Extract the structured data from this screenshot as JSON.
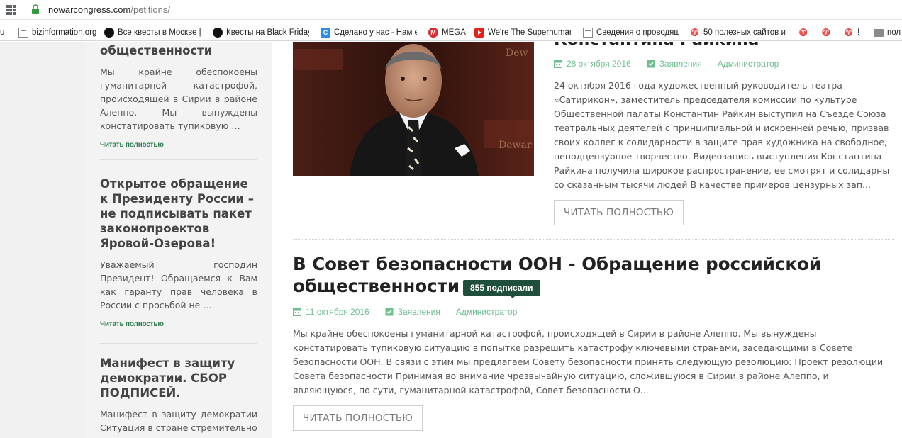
{
  "browser": {
    "url_host": "nowarcongress.com",
    "url_path": "/petitions/",
    "bookmarks": [
      {
        "label": "u",
        "icon": "none"
      },
      {
        "label": "bizinformation.org",
        "icon": "document-icon"
      },
      {
        "label": "Все квесты в Москве |",
        "icon": "quest-icon"
      },
      {
        "label": "Квесты на Black Friday",
        "icon": "quest-icon"
      },
      {
        "label": "Сделано у нас - Нам е",
        "icon": "c-icon"
      },
      {
        "label": "MEGA",
        "icon": "mega-icon"
      },
      {
        "label": "We're The Superhuman",
        "icon": "youtube-icon"
      },
      {
        "label": "Сведения о проводящ",
        "icon": "document-icon"
      },
      {
        "label": "50 полезных сайтов и",
        "icon": "red-icon"
      },
      {
        "label": "",
        "icon": "red-icon"
      },
      {
        "label": "",
        "icon": "red-icon"
      },
      {
        "label": "!",
        "icon": "red-icon"
      },
      {
        "label": "пол",
        "icon": "folder-icon"
      }
    ]
  },
  "sidebar": {
    "items": [
      {
        "title": "общественности",
        "excerpt": "Мы крайне обеспокоены гуманитарной катастрофой, происходящей в Сирии в районе Алеппо. Мы вынуждены констатировать тупиковую …",
        "read_more": "Читать полностью"
      },
      {
        "title": "Открытое обращение к Президенту России – не подписывать пакет законопроектов Яровой-Озерова!",
        "excerpt": "Уважаемый господин Президент! Обращаемся к Вам как гаранту прав человека в России с просьбой не …",
        "read_more": "Читать полностью"
      },
      {
        "title": "Манифест в защиту демократии. СБОР ПОДПИСЕЙ.",
        "excerpt": "Манифест в защиту демократии Ситуация в стране стремительно"
      }
    ]
  },
  "posts": [
    {
      "title": "Константина Райкина",
      "date": "28 октября 2016",
      "category": "Заявления",
      "author": "Администратор",
      "excerpt": "24 октября 2016 года художественный руководитель театра «Сатирикон», заместитель председателя комиссии по культуре Общественной палаты Константин Райкин выступил на Съезде Союза театральных деятелей с принципиальной и искренней речью, призвав своих коллег к солидарности в защите прав художника на свободное, неподцензурное творчество. Видеозапись выступления Константина Райкина получила широкое распространение, ее смотрят и солидарны со сказанным тысячи людей В качестве примеров цензурных зап...",
      "read_more": "ЧИТАТЬ ПОЛНОСТЬЮ"
    },
    {
      "title": "В Совет безопасности ООН - Обращение российской общественности",
      "badge": "855 подписали",
      "date": "11 октября 2016",
      "category": "Заявления",
      "author": "Администратор",
      "excerpt": "Мы крайне обеспокоены гуманитарной катастрофой, происходящей в Сирии в районе Алеппо. Мы вынуждены констатировать тупиковую ситуацию в попытке разрешить катастрофу ключевыми странами, заседающими в Совете безопасности ООН. В связи с этим мы предлагаем Совету безопасности принять следующую резолюцию: Проект резолюции Совета безопасности Принимая во внимание чрезвычайную ситуацию, сложившуюся в Сирии в районе Алеппо, и являющуюся, по сути, гуманитарной катастрофой, Совет безопасности О...",
      "read_more": "ЧИТАТЬ ПОЛНОСТЬЮ"
    }
  ],
  "colors": {
    "accent_green": "#6fbf8e",
    "link_green": "#2e7d4f",
    "badge_bg": "#1f4f3a"
  }
}
